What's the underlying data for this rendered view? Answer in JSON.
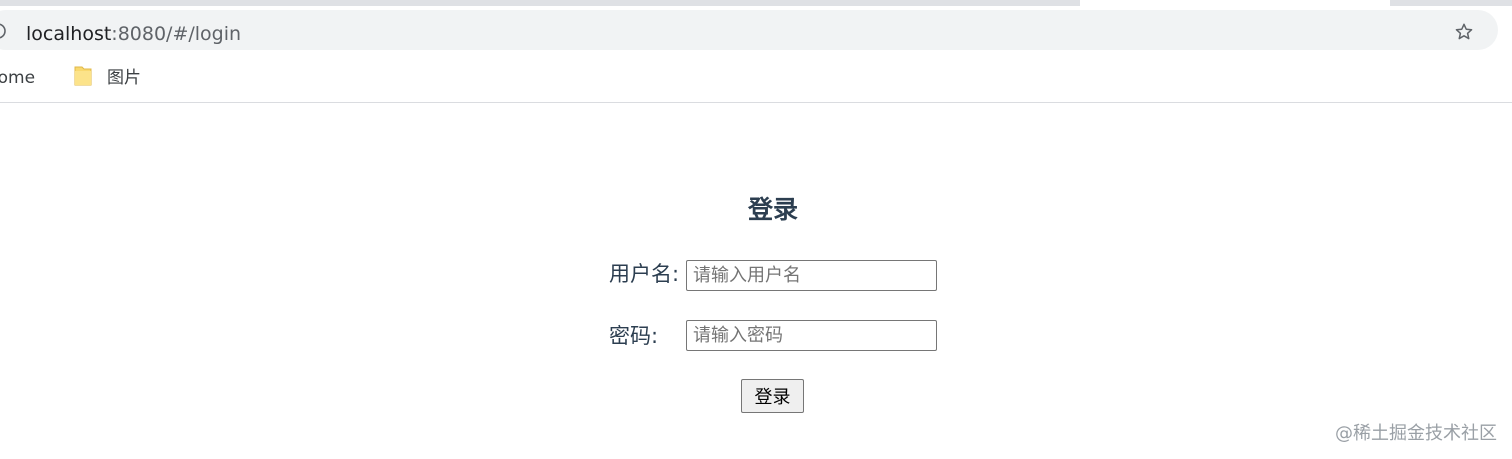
{
  "browser": {
    "url_host": "localhost",
    "url_rest": ":8080/#/login",
    "info_icon": "info-icon",
    "bookmark_icon": "star-icon",
    "bookmarks": [
      {
        "label": "rome"
      },
      {
        "label": "图片",
        "icon": "folder-icon",
        "icon_color": "#f9d96f"
      }
    ]
  },
  "login": {
    "title": "登录",
    "username_label": "用户名:",
    "username_placeholder": "请输入用户名",
    "password_label": "密码:",
    "password_placeholder": "请输入密码",
    "submit_label": "登录"
  },
  "watermark": "@稀土掘金技术社区",
  "colors": {
    "heading": "#2c3e50",
    "omnibox_bg": "#f1f3f4",
    "tabstrip_bg": "#dfe1e5"
  }
}
